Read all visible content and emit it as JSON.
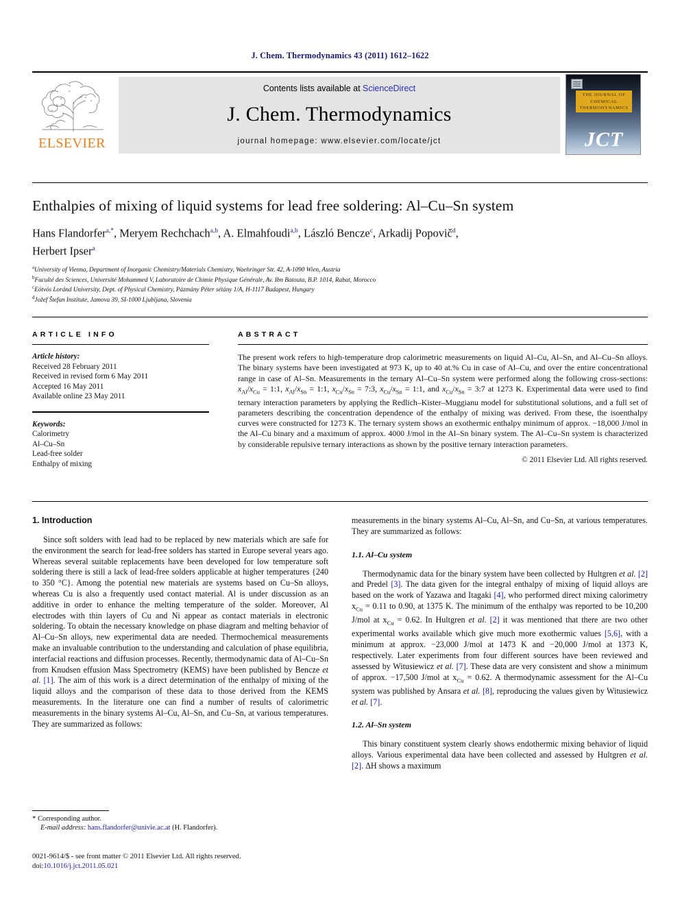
{
  "running_head": "J. Chem. Thermodynamics 43 (2011) 1612–1622",
  "masthead": {
    "publisher_name": "ELSEVIER",
    "contents_prefix": "Contents lists available at ",
    "contents_link": "ScienceDirect",
    "journal_name": "J. Chem. Thermodynamics",
    "homepage": "journal homepage: www.elsevier.com/locate/jct",
    "cover": {
      "title_lines": "THE JOURNAL OF CHEMICAL THERMODYNAMICS",
      "mark": "JCT"
    }
  },
  "title": "Enthalpies of mixing of liquid systems for lead free soldering: Al–Cu–Sn system",
  "authors_line_1": "Hans Flandorfer",
  "authors": [
    {
      "name": "Hans Flandorfer",
      "marks": "a,*"
    },
    {
      "name": "Meryem Rechchach",
      "marks": "a,b"
    },
    {
      "name": "A. Elmahfoudi",
      "marks": "a,b"
    },
    {
      "name": "László Bencze",
      "marks": "c"
    },
    {
      "name": "Arkadij Popovič",
      "marks": "d"
    },
    {
      "name": "Herbert Ipser",
      "marks": "a"
    }
  ],
  "affiliations": [
    {
      "mark": "a",
      "text": "University of Vienna, Department of Inorganic Chemistry/Materials Chemistry, Waehringer Str. 42, A-1090 Wien, Austria"
    },
    {
      "mark": "b",
      "text": "Faculté des Sciences, Université Mohammed V, Laboratoire de Chimie Physique Générale, Av. Ibn Batouta, B.P. 1014, Rabat, Morocco"
    },
    {
      "mark": "c",
      "text": "Eötvös Loránd University, Dept. of Physical Chemistry, Pázmány Péter sétány 1/A, H-1117 Budapest, Hungary"
    },
    {
      "mark": "d",
      "text": "Jožef Štefan Institute, Jamova 39, SI-1000 Ljubljana, Slovenia"
    }
  ],
  "article_info": {
    "heading": "ARTICLE INFO",
    "history_label": "Article history:",
    "history": [
      "Received 28 February 2011",
      "Received in revised form 6 May 2011",
      "Accepted 16 May 2011",
      "Available online 23 May 2011"
    ],
    "keywords_label": "Keywords:",
    "keywords": [
      "Calorimetry",
      "Al–Cu–Sn",
      "Lead-free solder",
      "Enthalpy of mixing"
    ]
  },
  "abstract": {
    "heading": "ABSTRACT",
    "copyright": "© 2011 Elsevier Ltd. All rights reserved."
  },
  "body": {
    "section_1_heading": "1. Introduction",
    "intro_p1_a": "Since soft solders with lead had to be replaced by new materials which are safe for the environment the search for lead-free solders has started in Europe several years ago. Whereas several suitable replacements have been developed for low temperature soft soldering there is still a lack of lead-free solders applicable at higher temperatures {240 to 350",
    "intro_p1_b": " °C}. Among the potential new materials are systems based on Cu–Sn alloys, whereas Cu is also a frequently used contact material. Al is under discussion as an additive in order to enhance the melting temperature of the solder. Moreover, Al electrodes with thin layers of Cu and Ni appear as contact materials in electronic soldering. To obtain the necessary knowledge on phase diagram and melting behavior of Al–Cu–Sn alloys, new experimental data are needed. Thermochemical measurements make an invaluable contribution to the understanding and calculation of phase equilibria, interfacial reactions and diffusion processes. Recently, thermodynamic data of Al–Cu–Sn from Knudsen effusion Mass Spectrometry (KEMS) have been published by Bencze ",
    "intro_ref_1": "[1]",
    "intro_p1_c": ". The aim of this work is a direct determination of the enthalpy of mixing of the liquid alloys and the comparison of these data to those derived from the KEMS measurements. In the literature one can find a number of results of calorimetric measurements in the binary systems Al–Cu, Al–Sn, and Cu–Sn, at various temperatures. They are summarized as follows:",
    "subsec_1_1": "1.1. Al–Cu system",
    "subsec_1_2": "1.2. Al–Sn system",
    "et_al": "et al.",
    "sec11_t1": "Thermodynamic data for the binary system have been collected by Hultgren ",
    "sec11_r2": "[2]",
    "sec11_t2": " and Predel ",
    "sec11_r3": "[3]",
    "sec11_t3": ". The data given for the integral enthalpy of mixing of liquid alloys are based on the work of Yazawa and Itagaki ",
    "sec11_r4": "[4]",
    "sec11_t4": ", who performed direct mixing calorimetry x",
    "sec11_t5": " = 0.11 to 0.90, at 1375 K. The minimum of the enthalpy was reported to be 10,200 J/mol at x",
    "sec11_t6": " = 0.62. In Hultgren ",
    "sec11_r5": "[2]",
    "sec11_t7": " it was mentioned that there are two other experimental works available which give much more exothermic values ",
    "sec11_r56": "[5,6]",
    "sec11_t8": ", with a minimum at approx. −23,000 J/mol at 1473 K and −20,000 J/mol at 1373 K, respectively. Later experiments from four different sources have been reviewed and assessed by Witusiewicz ",
    "sec11_r7": "[7]",
    "sec11_t9": ". These data are very consistent and show a minimum of approx. −17,500 J/mol at x",
    "sec11_t10": " = 0.62. A thermodynamic assessment for the Al–Cu system was published by Ansara ",
    "sec11_r8": "[8]",
    "sec11_t11": ", reproducing the values given by Witusiewicz ",
    "sec11_r7b": "[7]",
    "sec11_t12": ".",
    "sec12_t1": "This binary constituent system clearly shows endothermic mixing behavior of liquid alloys. Various experimental data have been collected and assessed by Hultgren ",
    "sec12_r2": "[2]",
    "sec12_t2": ". ΔH shows a maximum"
  },
  "footnote": {
    "corresponding": "Corresponding author.",
    "email_label": "E-mail address:",
    "email": "hans.flandorfer@univie.ac.at",
    "email_owner": "(H. Flandorfer)."
  },
  "imprint": {
    "issn_line": "0021-9614/$ - see front matter © 2011 Elsevier Ltd. All rights reserved.",
    "doi_label": "doi:",
    "doi": "10.1016/j.jct.2011.05.021"
  }
}
